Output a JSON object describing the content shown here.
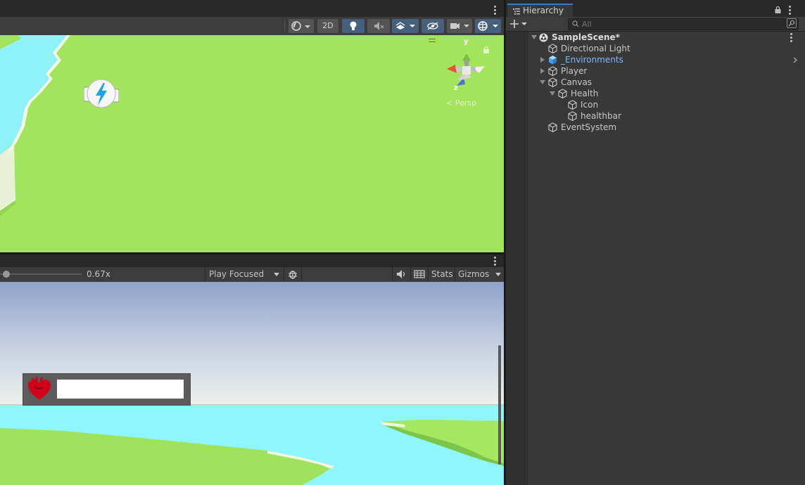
{
  "scene_toolbar": {
    "mode_2d_label": "2D",
    "icons": [
      "draw-mode-icon",
      "lighting-icon",
      "audio-icon",
      "effects-icon",
      "visibility-icon",
      "camera-icon",
      "gizmos-icon"
    ]
  },
  "scene_view": {
    "gizmo_axis_y": "y",
    "gizmo_axis_z": "z",
    "projection_label": "Persp"
  },
  "game_toolbar": {
    "scale_value": "0.67x",
    "play_mode_label": "Play Focused",
    "stats_label": "Stats",
    "gizmos_label": "Gizmos"
  },
  "hierarchy": {
    "tab_label": "Hierarchy",
    "search_placeholder": "All",
    "scene_name": "SampleScene*",
    "items": [
      {
        "label": "Directional Light"
      },
      {
        "label": "_Environments"
      },
      {
        "label": "Player"
      },
      {
        "label": "Canvas"
      },
      {
        "label": "Health"
      },
      {
        "label": "Icon"
      },
      {
        "label": "healthbar"
      },
      {
        "label": "EventSystem"
      }
    ]
  },
  "colors": {
    "accent": "#3a79bb",
    "selection_blue": "#46607c",
    "prefab_text": "#7db7f5",
    "grass": "#9ee35b",
    "water": "#8ff5ff",
    "health_icon_red": "#d0021b"
  }
}
